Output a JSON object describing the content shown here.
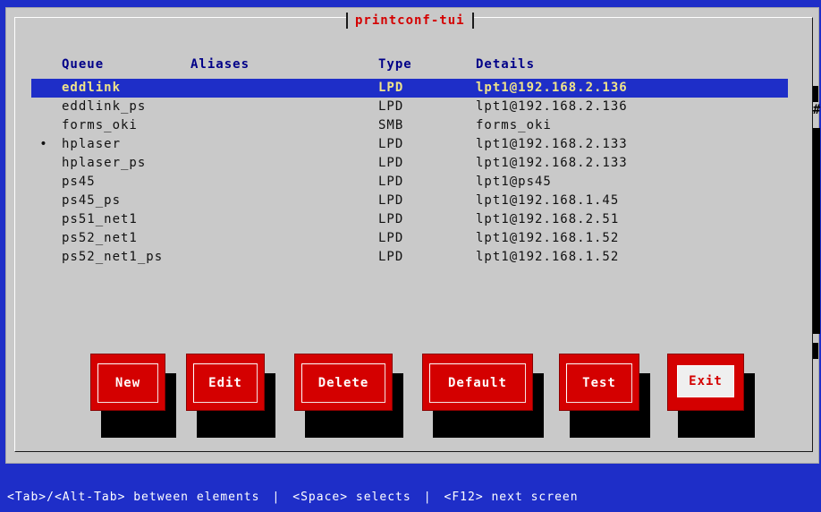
{
  "window": {
    "title": "printconf-tui"
  },
  "list": {
    "headers": {
      "queue": "Queue",
      "aliases": "Aliases",
      "type": "Type",
      "details": "Details"
    },
    "rows": [
      {
        "queue": "eddlink",
        "aliases": "",
        "type": "LPD",
        "details": "lpt1@192.168.2.136",
        "marker": "",
        "selected": true
      },
      {
        "queue": "eddlink_ps",
        "aliases": "",
        "type": "LPD",
        "details": "lpt1@192.168.2.136",
        "marker": "",
        "selected": false
      },
      {
        "queue": "forms_oki",
        "aliases": "",
        "type": "SMB",
        "details": "forms_oki",
        "marker": "",
        "selected": false
      },
      {
        "queue": "hplaser",
        "aliases": "",
        "type": "LPD",
        "details": "lpt1@192.168.2.133",
        "marker": "•",
        "selected": false
      },
      {
        "queue": "hplaser_ps",
        "aliases": "",
        "type": "LPD",
        "details": "lpt1@192.168.2.133",
        "marker": "",
        "selected": false
      },
      {
        "queue": "ps45",
        "aliases": "",
        "type": "LPD",
        "details": "lpt1@ps45",
        "marker": "",
        "selected": false
      },
      {
        "queue": "ps45_ps",
        "aliases": "",
        "type": "LPD",
        "details": "lpt1@192.168.1.45",
        "marker": "",
        "selected": false
      },
      {
        "queue": "ps51_net1",
        "aliases": "",
        "type": "LPD",
        "details": "lpt1@192.168.2.51",
        "marker": "",
        "selected": false
      },
      {
        "queue": "ps52_net1",
        "aliases": "",
        "type": "LPD",
        "details": "lpt1@192.168.1.52",
        "marker": "",
        "selected": false
      },
      {
        "queue": "ps52_net1_ps",
        "aliases": "",
        "type": "LPD",
        "details": "lpt1@192.168.1.52",
        "marker": "",
        "selected": false
      }
    ]
  },
  "scrollbar": {
    "thumb_symbol": "#"
  },
  "buttons": [
    {
      "label": "New"
    },
    {
      "label": "Edit"
    },
    {
      "label": "Delete"
    },
    {
      "label": "Default"
    },
    {
      "label": "Test"
    },
    {
      "label": "Exit"
    }
  ],
  "status": {
    "parts": [
      "<Tab>/<Alt-Tab> between elements",
      "<Space> selects",
      "<F12> next screen"
    ],
    "separator": "|"
  },
  "colors": {
    "screen_blue": "#1e2ec8",
    "dialog_gray": "#c9c9c9",
    "button_red": "#d40000",
    "header_blue": "#000088",
    "selected_text": "#f0e48a"
  }
}
